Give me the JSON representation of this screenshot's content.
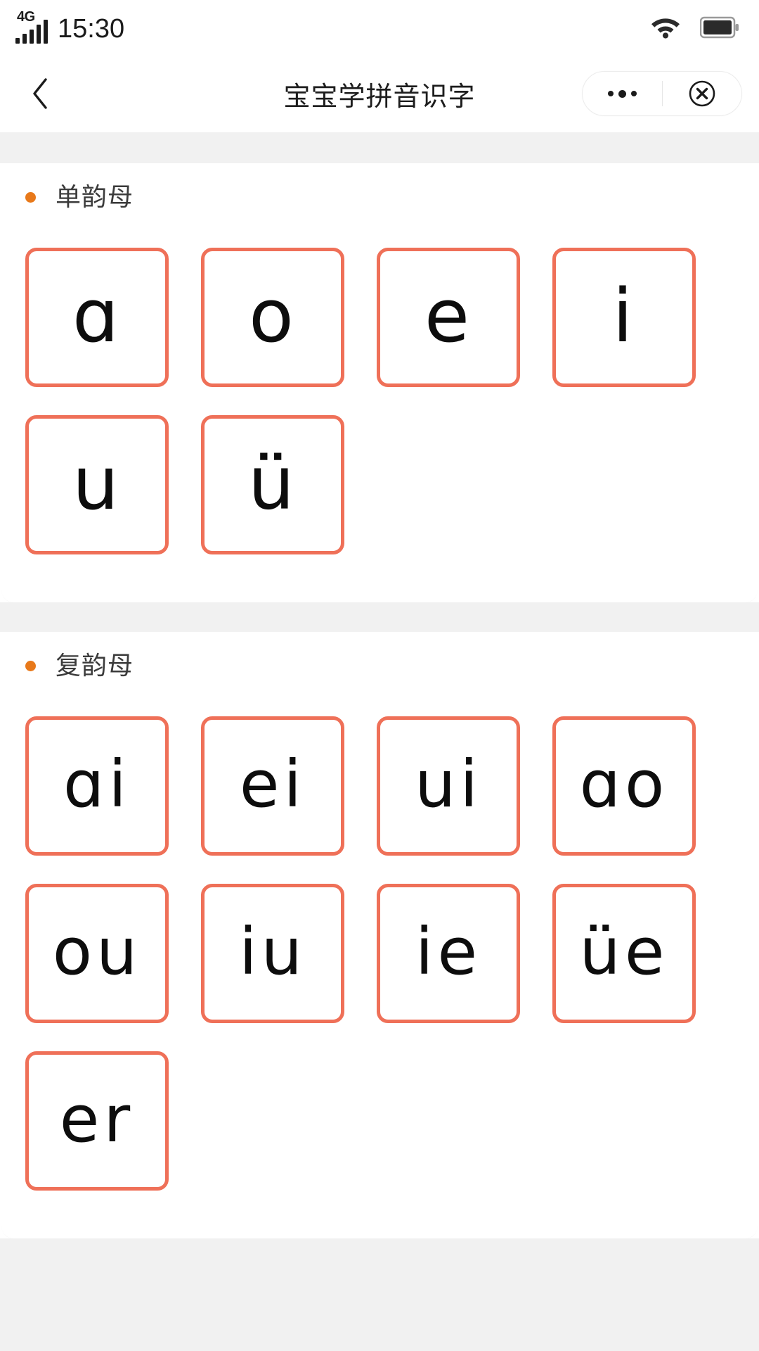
{
  "status_bar": {
    "network_label": "4G",
    "signal_bars": 5,
    "time": "15:30",
    "wifi_icon": "wifi-icon",
    "battery_icon": "battery-icon",
    "battery_level_percent": 95
  },
  "nav_bar": {
    "back_icon": "chevron-left-icon",
    "title": "宝宝学拼音识字",
    "capsule": {
      "more_icon": "more-dots-icon",
      "close_icon": "close-circle-icon"
    }
  },
  "theme": {
    "card_border_color": "#EF7058",
    "bullet_color": "#E8791A",
    "page_background": "#F1F1F1",
    "panel_background": "#FFFFFF",
    "text_color": "#0D0D0D",
    "section_title_color": "#3B3B3B"
  },
  "sections": [
    {
      "title": "单韵母",
      "bullet": "orange-dot",
      "cards": [
        "ɑ",
        "o",
        "e",
        "i",
        "u",
        "ü"
      ]
    },
    {
      "title": "复韵母",
      "bullet": "orange-dot",
      "cards": [
        "ɑi",
        "ei",
        "ui",
        "ɑo",
        "ou",
        "iu",
        "ie",
        "üe",
        "er"
      ]
    }
  ]
}
